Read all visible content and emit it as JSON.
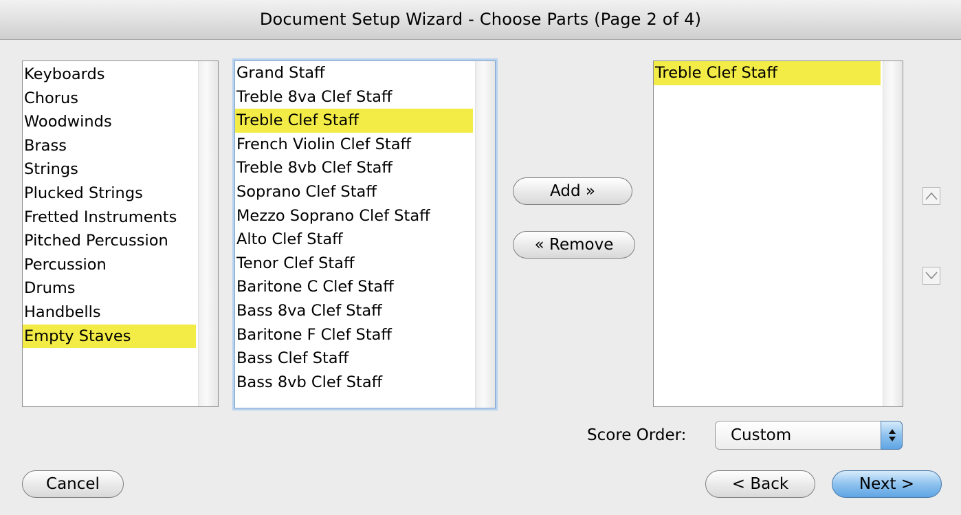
{
  "window": {
    "title": "Document Setup Wizard - Choose Parts (Page 2 of 4)",
    "clipped_text": "g"
  },
  "categories": {
    "items": [
      "Keyboards",
      "Chorus",
      "Woodwinds",
      "Brass",
      "Strings",
      "Plucked Strings",
      "Fretted Instruments",
      "Pitched Percussion",
      "Percussion",
      "Drums",
      "Handbells",
      "Empty Staves"
    ],
    "selected": "Empty Staves"
  },
  "instruments": {
    "items": [
      "Grand Staff",
      "Treble 8va Clef Staff",
      "Treble Clef Staff",
      "French Violin Clef Staff",
      "Treble 8vb Clef Staff",
      "Soprano Clef Staff",
      "Mezzo Soprano Clef Staff",
      "Alto Clef Staff",
      "Tenor Clef Staff",
      "Baritone C Clef Staff",
      "Bass 8va Clef Staff",
      "Baritone  F Clef Staff",
      "Bass Clef Staff",
      "Bass 8vb Clef Staff"
    ],
    "selected": "Treble Clef Staff"
  },
  "buttons": {
    "add": "Add »",
    "remove": "« Remove",
    "cancel": "Cancel",
    "back": "< Back",
    "next": "Next >"
  },
  "score": {
    "items": [
      "Treble Clef Staff"
    ],
    "selected": "Treble Clef Staff"
  },
  "score_order": {
    "label": "Score Order:",
    "value": "Custom"
  },
  "icons": {
    "move_up": "chevron-up-icon",
    "move_down": "chevron-down-icon",
    "stepper": "up-down-stepper-icon"
  },
  "colors": {
    "selection": "#f3ec46",
    "default_button": "#8ec2ee",
    "focus_ring": "#b9d3ee"
  }
}
